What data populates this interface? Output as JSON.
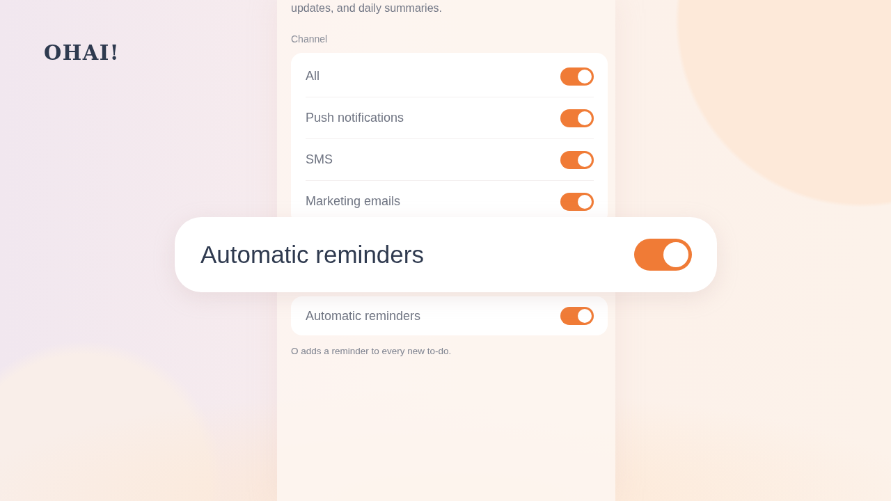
{
  "logo": {
    "text": "OHAI!"
  },
  "settings_panel": {
    "intro_text": "updates, and daily summaries.",
    "channel_label": "Channel",
    "channels": [
      {
        "label": "All",
        "on": true
      },
      {
        "label": "Push notifications",
        "on": true
      },
      {
        "label": "SMS",
        "on": true
      },
      {
        "label": "Marketing emails",
        "on": true
      }
    ],
    "reminders": [
      {
        "label": "Automatic reminders",
        "on": true
      }
    ],
    "reminder_note": "O adds a reminder to every new to-do."
  },
  "highlight_card": {
    "label": "Automatic reminders",
    "on": true
  }
}
